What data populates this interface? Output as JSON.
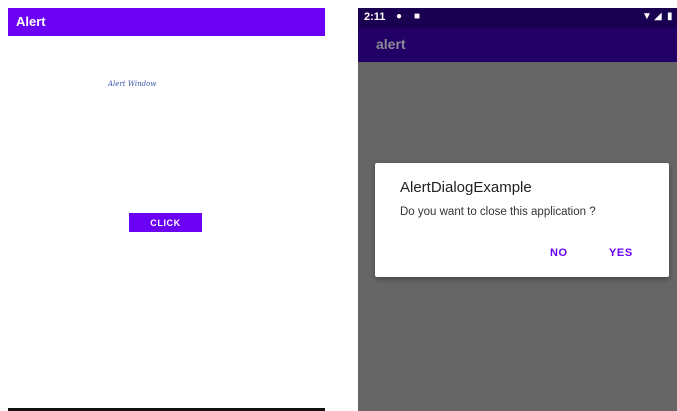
{
  "left_screen": {
    "app_title": "Alert",
    "subtitle": "Alert Window",
    "button_label": "CLICK"
  },
  "right_screen": {
    "status_time": "2:11",
    "app_title": "alert",
    "dialog": {
      "title": "AlertDialogExample",
      "message": "Do you want to close this application ?",
      "negative": "NO",
      "positive": "YES"
    }
  },
  "colors": {
    "primary": "#6a00f4",
    "dark_primary": "#220066",
    "scrim": "#666666"
  }
}
